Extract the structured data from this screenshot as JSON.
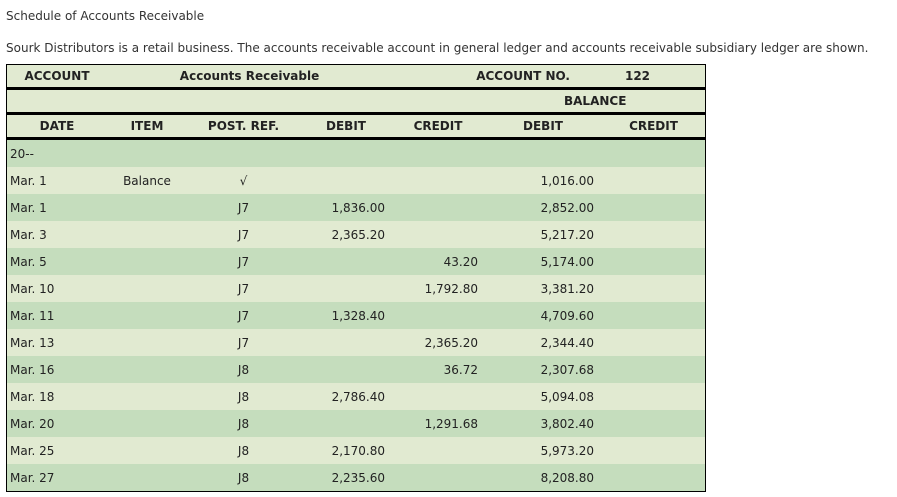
{
  "page": {
    "title": "Schedule of Accounts Receivable",
    "description": "Sourk Distributors is a retail business. The accounts receivable account in general ledger and accounts receivable subsidiary ledger are shown."
  },
  "ledger": {
    "account_label": "ACCOUNT",
    "account_name": "Accounts Receivable",
    "account_no_label": "ACCOUNT NO.",
    "account_no": "122",
    "balance_label": "BALANCE",
    "columns": {
      "date": "DATE",
      "item": "ITEM",
      "post_ref": "POST. REF.",
      "debit": "DEBIT",
      "credit": "CREDIT",
      "balance_debit": "DEBIT",
      "balance_credit": "CREDIT"
    },
    "rows": [
      {
        "date": "20--",
        "item": "",
        "post_ref": "",
        "debit": "",
        "credit": "",
        "balance_debit": "",
        "balance_credit": ""
      },
      {
        "date": "Mar. 1",
        "item": "Balance",
        "post_ref": "√",
        "debit": "",
        "credit": "",
        "balance_debit": "1,016.00",
        "balance_credit": ""
      },
      {
        "date": "Mar. 1",
        "item": "",
        "post_ref": "J7",
        "debit": "1,836.00",
        "credit": "",
        "balance_debit": "2,852.00",
        "balance_credit": ""
      },
      {
        "date": "Mar. 3",
        "item": "",
        "post_ref": "J7",
        "debit": "2,365.20",
        "credit": "",
        "balance_debit": "5,217.20",
        "balance_credit": ""
      },
      {
        "date": "Mar. 5",
        "item": "",
        "post_ref": "J7",
        "debit": "",
        "credit": "43.20",
        "balance_debit": "5,174.00",
        "balance_credit": ""
      },
      {
        "date": "Mar. 10",
        "item": "",
        "post_ref": "J7",
        "debit": "",
        "credit": "1,792.80",
        "balance_debit": "3,381.20",
        "balance_credit": ""
      },
      {
        "date": "Mar. 11",
        "item": "",
        "post_ref": "J7",
        "debit": "1,328.40",
        "credit": "",
        "balance_debit": "4,709.60",
        "balance_credit": ""
      },
      {
        "date": "Mar. 13",
        "item": "",
        "post_ref": "J7",
        "debit": "",
        "credit": "2,365.20",
        "balance_debit": "2,344.40",
        "balance_credit": ""
      },
      {
        "date": "Mar. 16",
        "item": "",
        "post_ref": "J8",
        "debit": "",
        "credit": "36.72",
        "balance_debit": "2,307.68",
        "balance_credit": ""
      },
      {
        "date": "Mar. 18",
        "item": "",
        "post_ref": "J8",
        "debit": "2,786.40",
        "credit": "",
        "balance_debit": "5,094.08",
        "balance_credit": ""
      },
      {
        "date": "Mar. 20",
        "item": "",
        "post_ref": "J8",
        "debit": "",
        "credit": "1,291.68",
        "balance_debit": "3,802.40",
        "balance_credit": ""
      },
      {
        "date": "Mar. 25",
        "item": "",
        "post_ref": "J8",
        "debit": "2,170.80",
        "credit": "",
        "balance_debit": "5,973.20",
        "balance_credit": ""
      },
      {
        "date": "Mar. 27",
        "item": "",
        "post_ref": "J8",
        "debit": "2,235.60",
        "credit": "",
        "balance_debit": "8,208.80",
        "balance_credit": ""
      }
    ]
  },
  "colors": {
    "header_bg": "#e1ead1",
    "row_shade": "#c5ddbd",
    "row_light": "#e1ead1",
    "border": "#000000"
  }
}
